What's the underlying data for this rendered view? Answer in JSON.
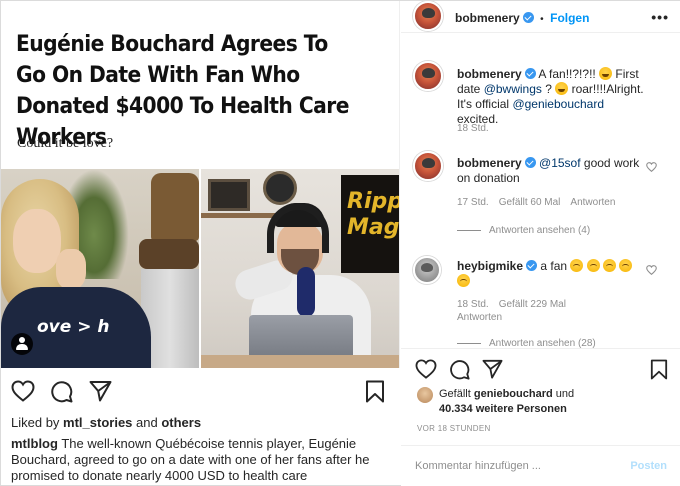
{
  "article": {
    "headline": "Eugénie Bouchard Agrees To Go On Date With Fan Who Donated $4000 To Health Care Workers",
    "subline": "Could it be love?",
    "shirt_text": "ove > h",
    "poster_text": "Ripp Mag"
  },
  "post_actions": {
    "liked_by_prefix": "Liked by ",
    "liked_by_user": "mtl_stories",
    "liked_by_mid": " and ",
    "liked_by_others": "others"
  },
  "caption": {
    "user": "mtlblog",
    "text": " The well-known Québécoise tennis player, Eugénie Bouchard, agreed to go on a date with one of her fans after he promised to donate nearly 4000 USD to health care"
  },
  "side": {
    "header": {
      "username": "bobmenery",
      "separator": "•",
      "follow_label": "Folgen",
      "more_label": "•••"
    },
    "comments": [
      {
        "user": "bobmenery",
        "text_a": " A fan!!?!?!! ",
        "text_b": " First date ",
        "mention1": "@bwwings",
        "text_c": " ? ",
        "text_d": " roar!!!!Alright. It's official ",
        "mention2": "@geniebouchard",
        "text_e": " excited.",
        "time": "18 Std."
      },
      {
        "user": "bobmenery",
        "mention": "@15sof",
        "text": " good work on donation",
        "time": "17 Std.",
        "likes": "Gefällt 60 Mal",
        "reply": "Antworten",
        "view_replies": "Antworten ansehen (4)"
      },
      {
        "user": "heybigmike",
        "text": " a fan ",
        "time": "18 Std.",
        "likes": "Gefällt 229 Mal",
        "reply": "Antworten",
        "view_replies": "Antworten ansehen (28)"
      }
    ],
    "liked_by": {
      "prefix": "Gefällt ",
      "user": "geniebouchard",
      "mid": " und",
      "count": "40.334 weitere Personen"
    },
    "timestamp": "VOR 18 STUNDEN",
    "add_comment_placeholder": "Kommentar hinzufügen ...",
    "post_label": "Posten"
  },
  "colors": {
    "link_blue": "#0095f6",
    "verified_blue": "#3897f0",
    "muted": "#8e8e8e",
    "mention": "#00376b"
  },
  "icons": [
    "heart-icon",
    "comment-icon",
    "share-icon",
    "bookmark-icon",
    "verified-icon",
    "more-icon",
    "user-tag-icon"
  ]
}
